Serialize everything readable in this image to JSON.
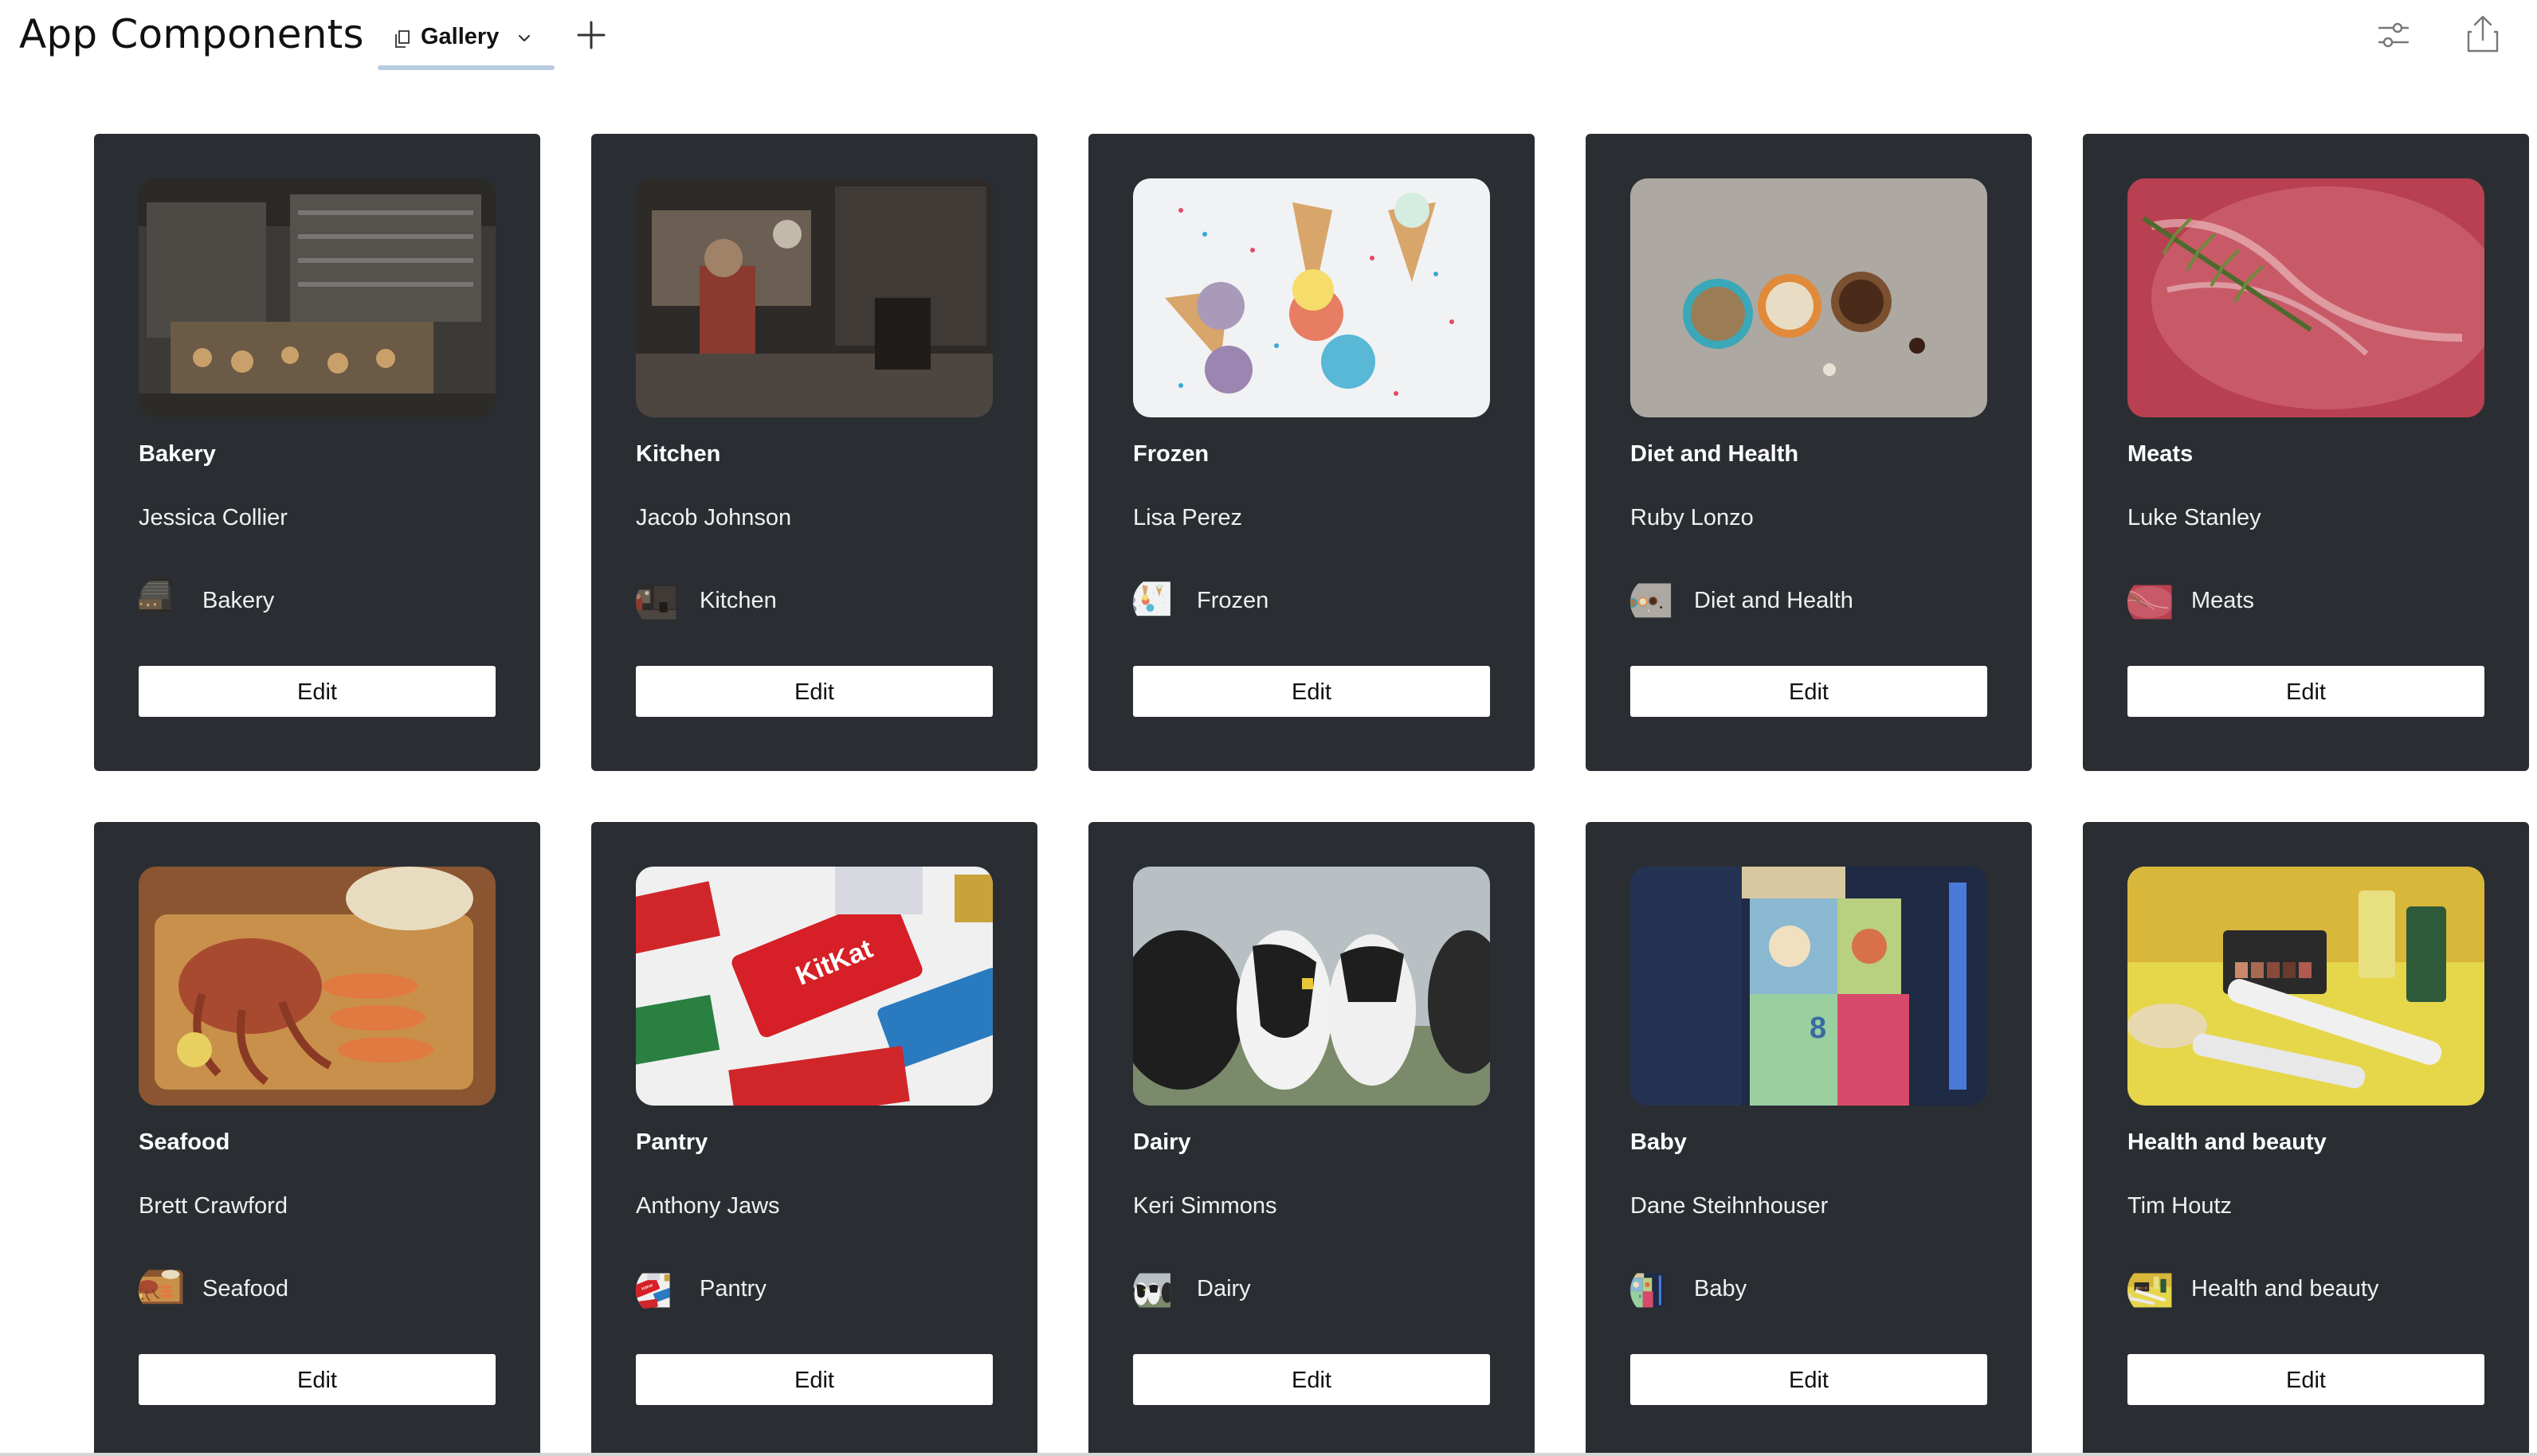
{
  "header": {
    "title": "App Components",
    "tab_label": "Gallery",
    "icons": [
      "tab-page-icon",
      "chevron-down-icon",
      "plus-icon",
      "sliders-icon",
      "share-icon"
    ]
  },
  "gallery": {
    "cards": [
      {
        "title": "Bakery",
        "person": "Jessica Collier",
        "chip": "Bakery",
        "button": "Edit"
      },
      {
        "title": "Kitchen",
        "person": "Jacob Johnson",
        "chip": "Kitchen",
        "button": "Edit"
      },
      {
        "title": "Frozen",
        "person": "Lisa Perez",
        "chip": "Frozen",
        "button": "Edit"
      },
      {
        "title": "Diet and Health",
        "person": "Ruby Lonzo",
        "chip": "Diet and Health",
        "button": "Edit"
      },
      {
        "title": "Meats",
        "person": "Luke Stanley",
        "chip": "Meats",
        "button": "Edit"
      },
      {
        "title": "Seafood",
        "person": "Brett Crawford",
        "chip": "Seafood",
        "button": "Edit"
      },
      {
        "title": "Pantry",
        "person": "Anthony Jaws",
        "chip": "Pantry",
        "button": "Edit"
      },
      {
        "title": "Dairy",
        "person": "Keri Simmons",
        "chip": "Dairy",
        "button": "Edit"
      },
      {
        "title": "Baby",
        "person": "Dane Steihnhouser",
        "chip": "Baby",
        "button": "Edit"
      },
      {
        "title": "Health and beauty",
        "person": "Tim Houtz",
        "chip": "Health and beauty",
        "button": "Edit"
      }
    ]
  },
  "colors": {
    "card_bg": "#2a2e33",
    "tab_underline": "#b9cde0",
    "button_bg": "#ffffff"
  }
}
